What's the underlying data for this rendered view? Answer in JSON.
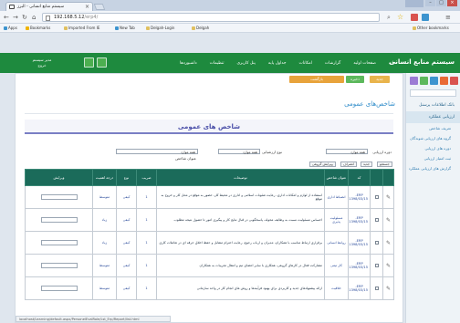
{
  "browser": {
    "tab_title": "سیستم منابع انسانی - البرز",
    "close_glyph": "×",
    "url_host": "192.168.5.12",
    "url_path": "/erp4/",
    "bookmarks": [
      "Apps",
      "Bookmarks",
      "Imported From IE",
      "New Tab",
      "Delgah-Login",
      "Delgah"
    ],
    "other_bookmarks": "Other bookmarks",
    "status_url": "localhost/Learning/default.aspx/PersonelEvalRole/Lst_Erp/Report/list.html"
  },
  "app": {
    "brand": "سیستم منابع انسانی",
    "nav": [
      "خانه",
      "صفحات اولیه",
      "گزارشات",
      "امکانات",
      "جداول پایه",
      "پنل کاربری",
      "تنظیمات",
      "داشبوردها"
    ],
    "user_line1": "مدیر سیستم",
    "user_line2": "خروج"
  },
  "sidebar": {
    "tiles": [
      "#d9534f",
      "#e96a35",
      "#3d94cf",
      "#5cb85c",
      "#9b7bd4"
    ],
    "items": [
      {
        "label": "بانک اطلاعات پرسنل",
        "active": false,
        "sub": false
      },
      {
        "label": "ارزیابی عملکرد",
        "active": true,
        "sub": false
      },
      {
        "label": "تعریف شاخص",
        "active": false,
        "sub": true
      },
      {
        "label": "گروه های ارزیابی شوندگان",
        "active": false,
        "sub": true
      },
      {
        "label": "دوره های ارزیابی",
        "active": false,
        "sub": true
      },
      {
        "label": "ثبت امتیاز ارزیابی",
        "active": false,
        "sub": true
      },
      {
        "label": "گزارش های ارزیابی عملکرد",
        "active": false,
        "sub": true
      }
    ]
  },
  "toolbar": {
    "buttons": [
      {
        "label": "بازگشت",
        "color": "#e8a33b"
      },
      {
        "label": "ذخیره",
        "color": "#5cb85c"
      },
      {
        "label": "جدید",
        "color": "#e9b44c"
      }
    ]
  },
  "page": {
    "title": "شاخص‌های عمومی",
    "section_title": "شاخص های عمومی",
    "filters": [
      {
        "label": "دوره ارزیابی",
        "value": "همه موارد"
      },
      {
        "label": "نوع ارزشیابی",
        "value": "همه موارد"
      },
      {
        "label": "عنوان شاخص",
        "value": "همه موارد"
      }
    ],
    "mini_tabs": [
      "جستجو",
      "جدید",
      "انصراف",
      "ویرایش گروهی"
    ]
  },
  "table": {
    "headers": [
      "کد",
      "تاریخ ثبت",
      "عنوان شاخص",
      "عنوان شاخص کامل",
      "توضیحات",
      "ضریب",
      "نوع",
      "درجه اهمیت",
      "ویرایش"
    ],
    "rows": [
      {
        "code": "ERP-",
        "date": "1398/03/15",
        "short": "انضباط اداری",
        "desc": "استفاده از لوازم و امکانات اداری، رعایت شئونات اسلامی و اداری در محیط کار، حضور به موقع در محل کار و خروج به موقع",
        "weight": "1",
        "type": "کیفی",
        "level": "متوسط"
      },
      {
        "code": "ERP-",
        "date": "1398/03/15",
        "short": "مسئولیت پذیری",
        "desc": "احساس مسئولیت نسبت به وظایف محوله، پاسخگویی در قبال نتایج کار و پیگیری امور تا حصول نتیجه مطلوب",
        "weight": "1",
        "type": "کیفی",
        "level": "زیاد"
      },
      {
        "code": "ERP-",
        "date": "1398/03/15",
        "short": "روابط انسانی",
        "desc": "برقراری ارتباط مناسب با همکاران، مدیران و ارباب رجوع، رعایت احترام متقابل و حفظ اخلاق حرفه ای در تعاملات کاری",
        "weight": "1",
        "type": "کیفی",
        "level": "زیاد"
      },
      {
        "code": "ERP-",
        "date": "1398/03/15",
        "short": "کار تیمی",
        "desc": "مشارکت فعال در کارهای گروهی، همکاری با سایر اعضای تیم و انتقال تجربیات به همکاران",
        "weight": "1",
        "type": "کیفی",
        "level": "متوسط"
      },
      {
        "code": "ERP-",
        "date": "1398/03/15",
        "short": "خلاقیت",
        "desc": "ارائه پیشنهادهای جدید و کاربردی برای بهبود فرآیندها و روش های انجام کار در واحد سازمانی",
        "weight": "1",
        "type": "کیفی",
        "level": "متوسط"
      }
    ]
  }
}
